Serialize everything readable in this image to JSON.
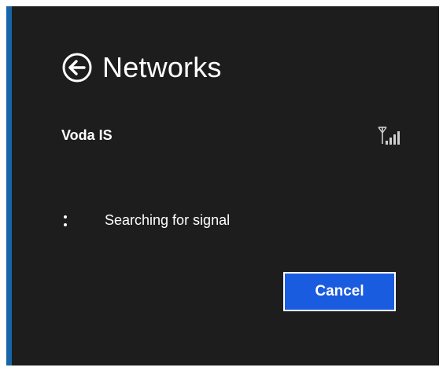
{
  "header": {
    "back_icon": "back-arrow-circle-icon",
    "title": "Networks"
  },
  "network": {
    "name": "Voda IS",
    "signal_icon": "cellular-signal-icon"
  },
  "status": {
    "progress_icon": "progress-dots-icon",
    "text": "Searching for signal"
  },
  "actions": {
    "cancel_label": "Cancel"
  },
  "colors": {
    "background": "#1d1d1d",
    "accent_strip": "#1565a8",
    "button": "#1a5ce0",
    "text": "#ffffff"
  }
}
